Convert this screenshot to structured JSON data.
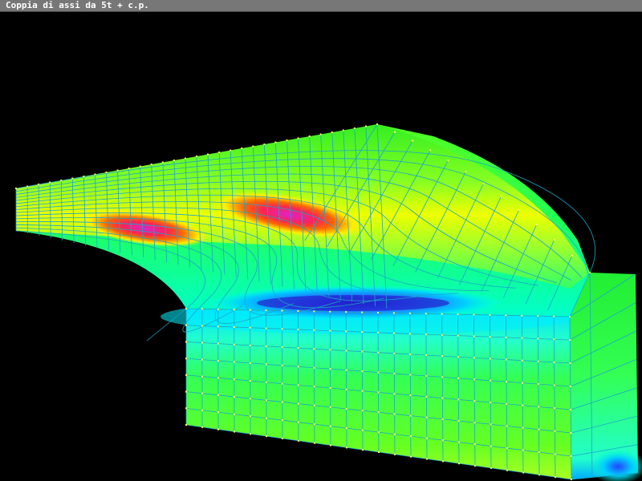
{
  "window": {
    "title": "Coppia di assi da 5t + c.p."
  },
  "viewport": {
    "background": "#000000",
    "mesh_line_color": "#1aa6c8",
    "node_color": "#ffff66"
  },
  "colors": {
    "titlebar": "#777777",
    "field_low": "#2233dd",
    "field_low_mid": "#00e8ff",
    "field_mid": "#33ff33",
    "field_high_mid": "#ffff00",
    "field_high": "#ff2200",
    "field_peak": "#ff33cc"
  },
  "icons": {
    "mesh": "fem-mesh-icon"
  }
}
